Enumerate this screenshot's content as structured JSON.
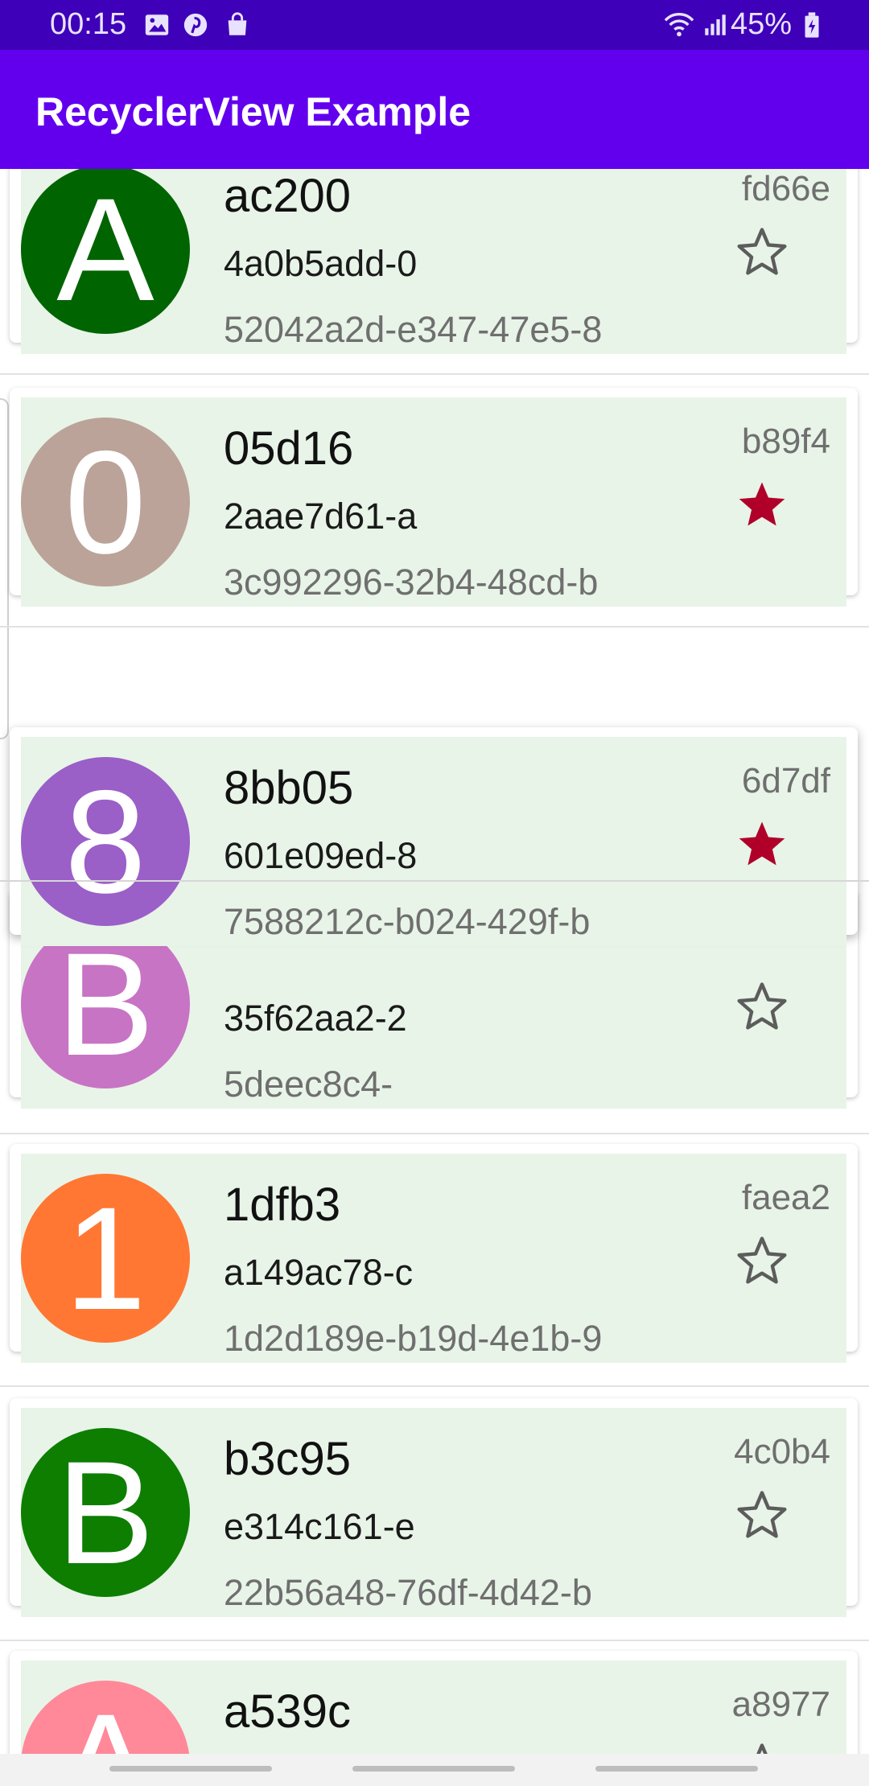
{
  "status": {
    "time": "00:15",
    "battery": "45%",
    "icons": [
      "gallery-icon",
      "pinterest-icon",
      "shopping-bag-icon",
      "wifi-icon",
      "signal-icon",
      "battery-icon"
    ]
  },
  "app_bar": {
    "title": "RecyclerView Example",
    "color": "#6200ee"
  },
  "colors": {
    "status_bar": "#3e00b8",
    "card_bg": "#e8f4e8",
    "star_active": "#b0002a",
    "star_inactive": "#5c5c5c"
  },
  "items": [
    {
      "title": "ac200",
      "sub": "4a0b5add-0",
      "uuid": "52042a2d-e347-47e5-8",
      "tag": "fd66e",
      "letter": "A",
      "color": "#006400",
      "starred": false
    },
    {
      "title": "05d16",
      "sub": "2aae7d61-a",
      "uuid": "3c992296-32b4-48cd-b",
      "tag": "b89f4",
      "letter": "0",
      "color": "#bba399",
      "starred": true
    },
    {
      "title": "8bb05",
      "sub": "601e09ed-8",
      "uuid": "7588212c-b024-429f-b",
      "tag": "6d7df",
      "letter": "8",
      "color": "#9b5fc8",
      "starred": true
    },
    {
      "title": "",
      "sub": "35f62aa2-2",
      "uuid": "5deec8c4-",
      "tag": "",
      "letter": "B",
      "color": "#c774c5",
      "starred": false
    },
    {
      "title": "1dfb3",
      "sub": "a149ac78-c",
      "uuid": "1d2d189e-b19d-4e1b-9",
      "tag": "faea2",
      "letter": "1",
      "color": "#ff7733",
      "starred": false
    },
    {
      "title": "b3c95",
      "sub": "e314c161-e",
      "uuid": "22b56a48-76df-4d42-b",
      "tag": "4c0b4",
      "letter": "B",
      "color": "#0d7e00",
      "starred": false
    },
    {
      "title": "a539c",
      "sub": "",
      "uuid": "",
      "tag": "a8977",
      "letter": "A",
      "color": "#ff8899",
      "starred": false
    }
  ]
}
